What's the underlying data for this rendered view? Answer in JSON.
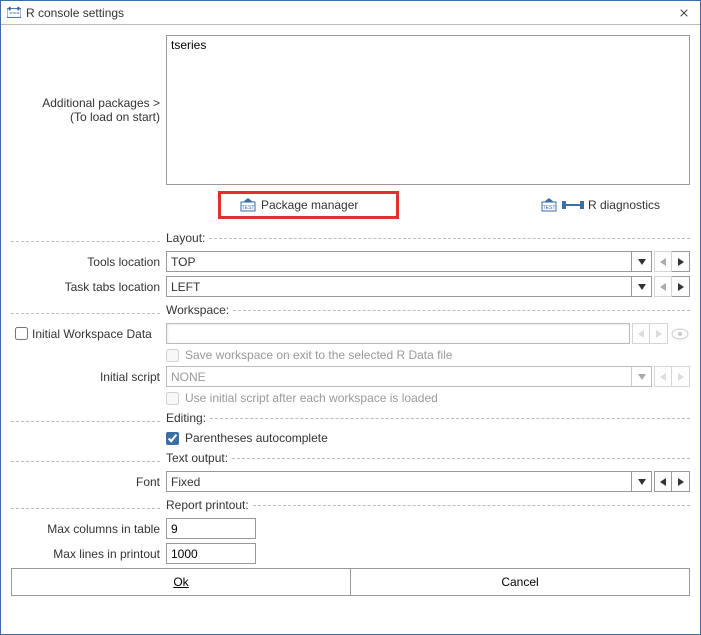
{
  "window": {
    "title": "R console settings"
  },
  "packages": {
    "label_line1": "Additional packages >",
    "label_line2": "(To load on start)",
    "value": "tseries",
    "manager_link": "Package manager",
    "diagnostics_link": "R diagnostics"
  },
  "sections": {
    "layout": "Layout:",
    "workspace": "Workspace:",
    "editing": "Editing:",
    "text_output": "Text output:",
    "report_printout": "Report printout:"
  },
  "fields": {
    "tools_location": {
      "label": "Tools location",
      "value": "TOP"
    },
    "task_tabs_location": {
      "label": "Task tabs location",
      "value": "LEFT"
    },
    "initial_workspace": {
      "label": "Initial Workspace Data",
      "value": ""
    },
    "save_on_exit": {
      "label": "Save workspace on exit to the selected R Data file"
    },
    "initial_script": {
      "label": "Initial script",
      "value": "NONE"
    },
    "use_initial_script": {
      "label": "Use initial script after each workspace is loaded"
    },
    "paren_autocomplete": {
      "label": "Parentheses autocomplete"
    },
    "font": {
      "label": "Font",
      "value": "Fixed"
    },
    "max_cols": {
      "label": "Max columns in table",
      "value": "9"
    },
    "max_lines": {
      "label": "Max lines in printout",
      "value": "1000"
    }
  },
  "buttons": {
    "ok": "Ok",
    "cancel": "Cancel"
  }
}
